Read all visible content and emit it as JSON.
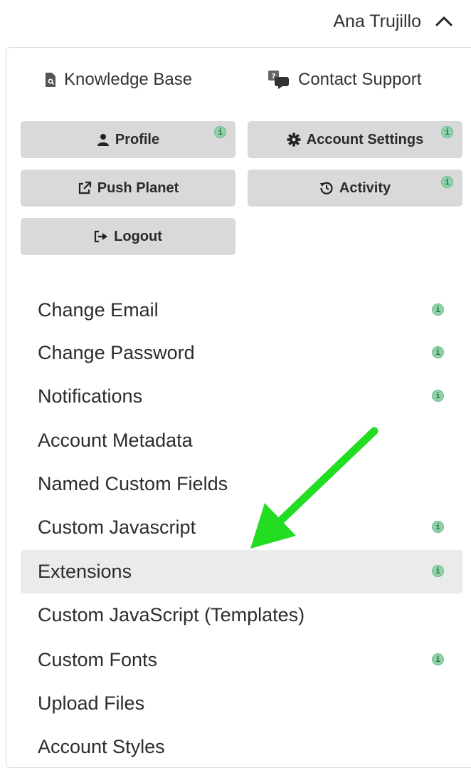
{
  "user": {
    "name": "Ana Trujillo"
  },
  "top_links": {
    "knowledge_base": "Knowledge Base",
    "contact_support": "Contact Support"
  },
  "buttons": {
    "profile": "Profile",
    "account_settings": "Account Settings",
    "push_planet": "Push Planet",
    "activity": "Activity",
    "logout": "Logout"
  },
  "info_glyph": "i",
  "menu": {
    "items": [
      {
        "label": "Change Email",
        "info": true
      },
      {
        "label": "Change Password",
        "info": true
      },
      {
        "label": "Notifications",
        "info": true
      },
      {
        "label": "Account Metadata",
        "info": false
      },
      {
        "label": "Named Custom Fields",
        "info": false
      },
      {
        "label": "Custom Javascript",
        "info": true
      },
      {
        "label": "Extensions",
        "info": true,
        "active": true
      },
      {
        "label": "Custom JavaScript (Templates)",
        "info": false
      },
      {
        "label": "Custom Fonts",
        "info": true
      },
      {
        "label": "Upload Files",
        "info": false
      },
      {
        "label": "Account Styles",
        "info": false
      }
    ]
  },
  "colors": {
    "button_bg": "#d9d9d9",
    "info_badge": "#8fd1a8",
    "active_row": "#ebebeb",
    "annotation_arrow": "#22dd22"
  }
}
